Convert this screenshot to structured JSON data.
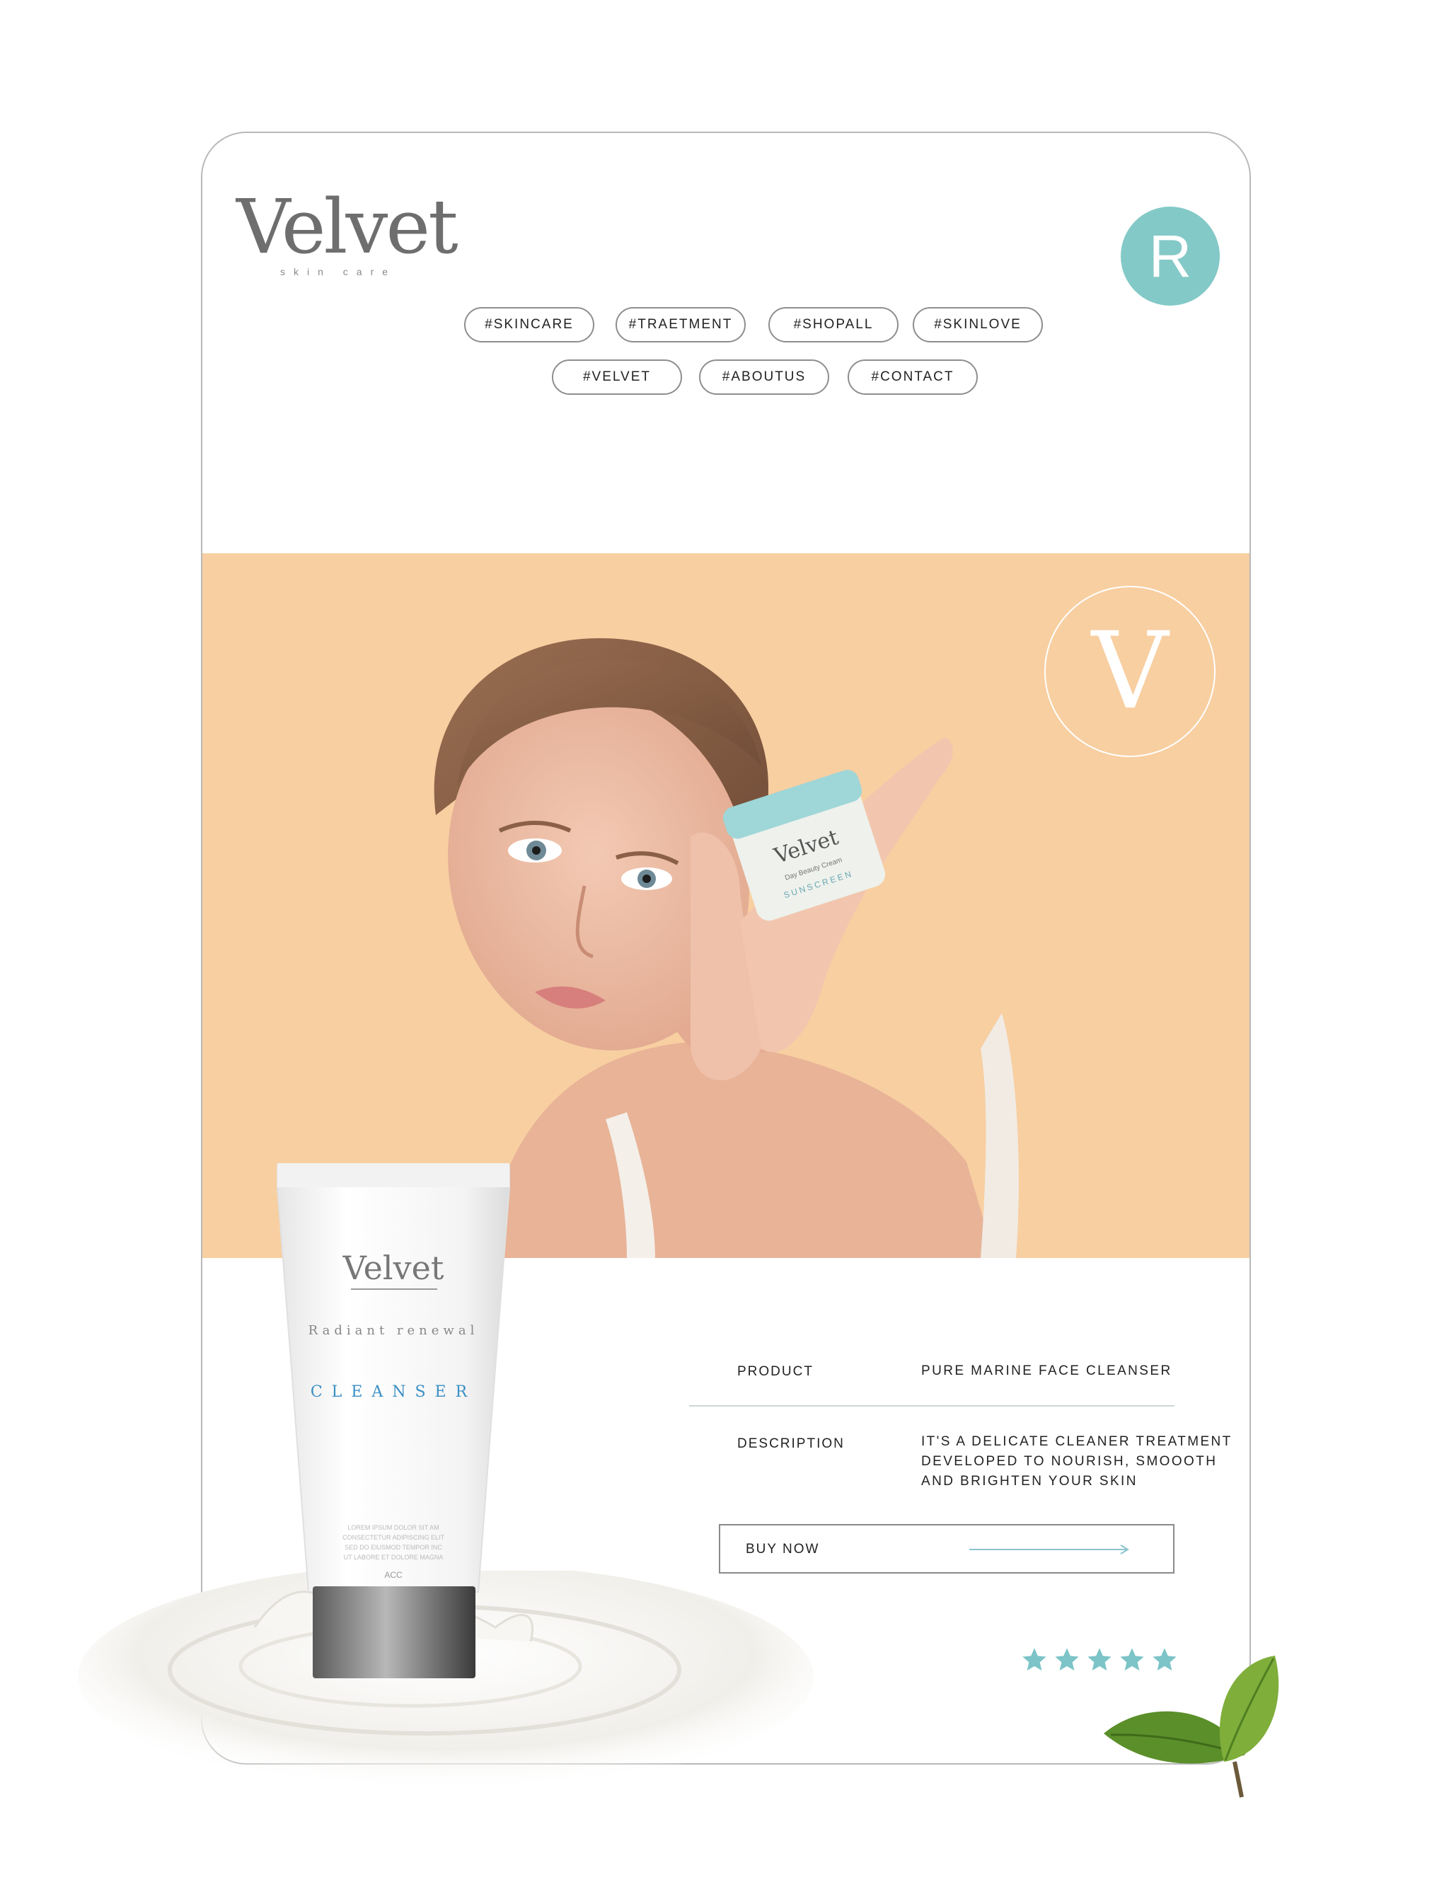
{
  "brand": {
    "name": "Velvet",
    "tagline": "skin care",
    "emblem_letter": "V"
  },
  "avatar": {
    "letter": "R",
    "color": "#83c9c7"
  },
  "nav": {
    "items": [
      "#SKINCARE",
      "#TRAETMENT",
      "#SHOPALL",
      "#SKINLOVE",
      "#VELVET",
      "#ABOUTUS",
      "#CONTACT"
    ]
  },
  "hero": {
    "background": "#f8cfa1"
  },
  "jar": {
    "brand": "Velvet",
    "line1": "Day Beauty Cream",
    "line2": "SUNSCREEN"
  },
  "tube": {
    "brand": "Velvet",
    "subtitle": "Radiant renewal",
    "name": "CLEANSER",
    "fine_print_1": "LOREM IPSUM DOLOR SIT AM",
    "fine_print_2": "CONSECTETUR ADIPISCING ELIT",
    "fine_print_3": "SED DO EIUSMOD TEMPOR INC",
    "fine_print_4": "UT LABORE ET DOLORE MAGNA",
    "code": "ACC",
    "accent": "#3b8fc4"
  },
  "product": {
    "product_label": "PRODUCT",
    "product_value": "PURE MARINE FACE CLEANSER",
    "description_label": "DESCRIPTION",
    "description_lines": [
      "IT'S A DELICATE CLEANER TREATMENT",
      "DEVELOPED TO NOURISH, SMOOOTH",
      "AND BRIGHTEN YOUR SKIN"
    ]
  },
  "cta": {
    "label": "BUY NOW",
    "arrow_color": "#8cc3cf"
  },
  "rating": {
    "stars": 5,
    "max": 5,
    "color": "#7cc4c7"
  }
}
